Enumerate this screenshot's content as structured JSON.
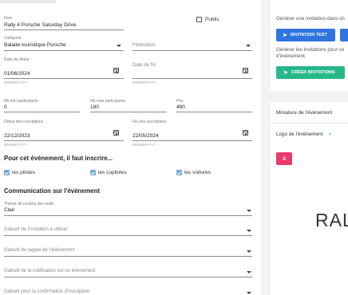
{
  "form": {
    "nom": {
      "label": "Nom",
      "value": "Rally 4 Porsche Saturday Drive"
    },
    "public_label": "Public",
    "categorie": {
      "label": "Catégorie",
      "value": "Balade touristique Porsche"
    },
    "federation": {
      "placeholder": "Fédération"
    },
    "date_debut": {
      "label": "Date de début",
      "value": "01/06/2024",
      "hint": "DD/MM/YYYY"
    },
    "date_fin": {
      "label": "Date de fin",
      "hint": "DD/MM/YYYY"
    },
    "nb_min": {
      "label": "Nb min participants",
      "value": "0"
    },
    "nb_max": {
      "label": "Nb max participants",
      "value": "180"
    },
    "prix": {
      "label": "Prix",
      "value": "490"
    },
    "debut_inscriptions": {
      "label": "Début des inscriptions",
      "value": "22/12/2023",
      "hint": "DD/MM/YYYY"
    },
    "fin_inscriptions": {
      "label": "Fin des inscriptions",
      "value": "22/05/2024",
      "hint": "DD/MM/YYYY"
    },
    "inscription_heading": "Pour cet événement, il faut inscrire...",
    "checkboxes": [
      {
        "label": "les pilotes",
        "checked": true
      },
      {
        "label": "les copilotes",
        "checked": true
      },
      {
        "label": "les voitures",
        "checked": true
      }
    ],
    "communication_heading": "Communication sur l'événement",
    "theme": {
      "label": "Thème de couleur des mails",
      "value": "Clair"
    },
    "gabarit_invitation": "Gabarit de l'invitation à utiliser",
    "gabarit_rappel": "Gabarit du rappel de l'événement",
    "gabarit_notification": "Gabarit de la notification sur un événement",
    "gabarit_confirmation": "Gabarit pour la confirmation d'inscription"
  },
  "invitations": {
    "generate_text": "Générer une invitation dans ch",
    "test_button": "INVITATION TEST",
    "generate_all_text_line1": "Générer les invitations pour vo",
    "generate_all_text_line2": "d'événement.",
    "create_button": "CRÉER INVITATIONS"
  },
  "thumbnail": {
    "title": "Miniature de l'événement",
    "logo_label": "Logo de l'événement",
    "remove_button": "X",
    "logo_text": "RAL"
  },
  "colors": {
    "primary": "#2f74e0",
    "success": "#27b889",
    "danger": "#ea3a6b",
    "checkbox": "#6ea9d8"
  }
}
